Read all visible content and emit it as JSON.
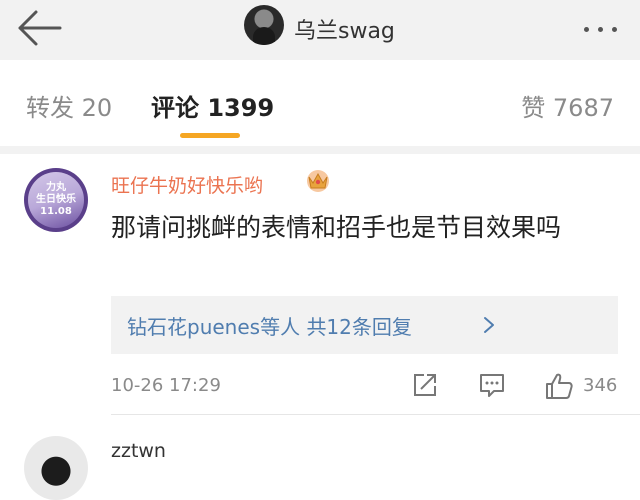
{
  "header": {
    "username": "乌兰swag",
    "back_icon": "back-arrow-icon",
    "more_icon": "more-dots-icon"
  },
  "tabs": {
    "repost_label": "转发 20",
    "comments_label": "评论 1399",
    "likes_label": "赞 7687",
    "active": "comments",
    "accent_color": "#f5a623"
  },
  "comments": [
    {
      "username": "旺仔牛奶好快乐哟",
      "avatar_text": "力丸\n生日快乐\n11.08",
      "badge_icon": "crown-icon",
      "text": "那请问挑衅的表情和招手也是节目效果吗",
      "replies_users": "钻石花puenes等人",
      "replies_count": "共12条回复",
      "timestamp": "10-26 17:29",
      "likes": "346"
    },
    {
      "username": "zztwn"
    }
  ],
  "colors": {
    "name_orange": "#eb7350",
    "link_blue": "#507daf",
    "muted_gray": "#8a8a8a"
  }
}
